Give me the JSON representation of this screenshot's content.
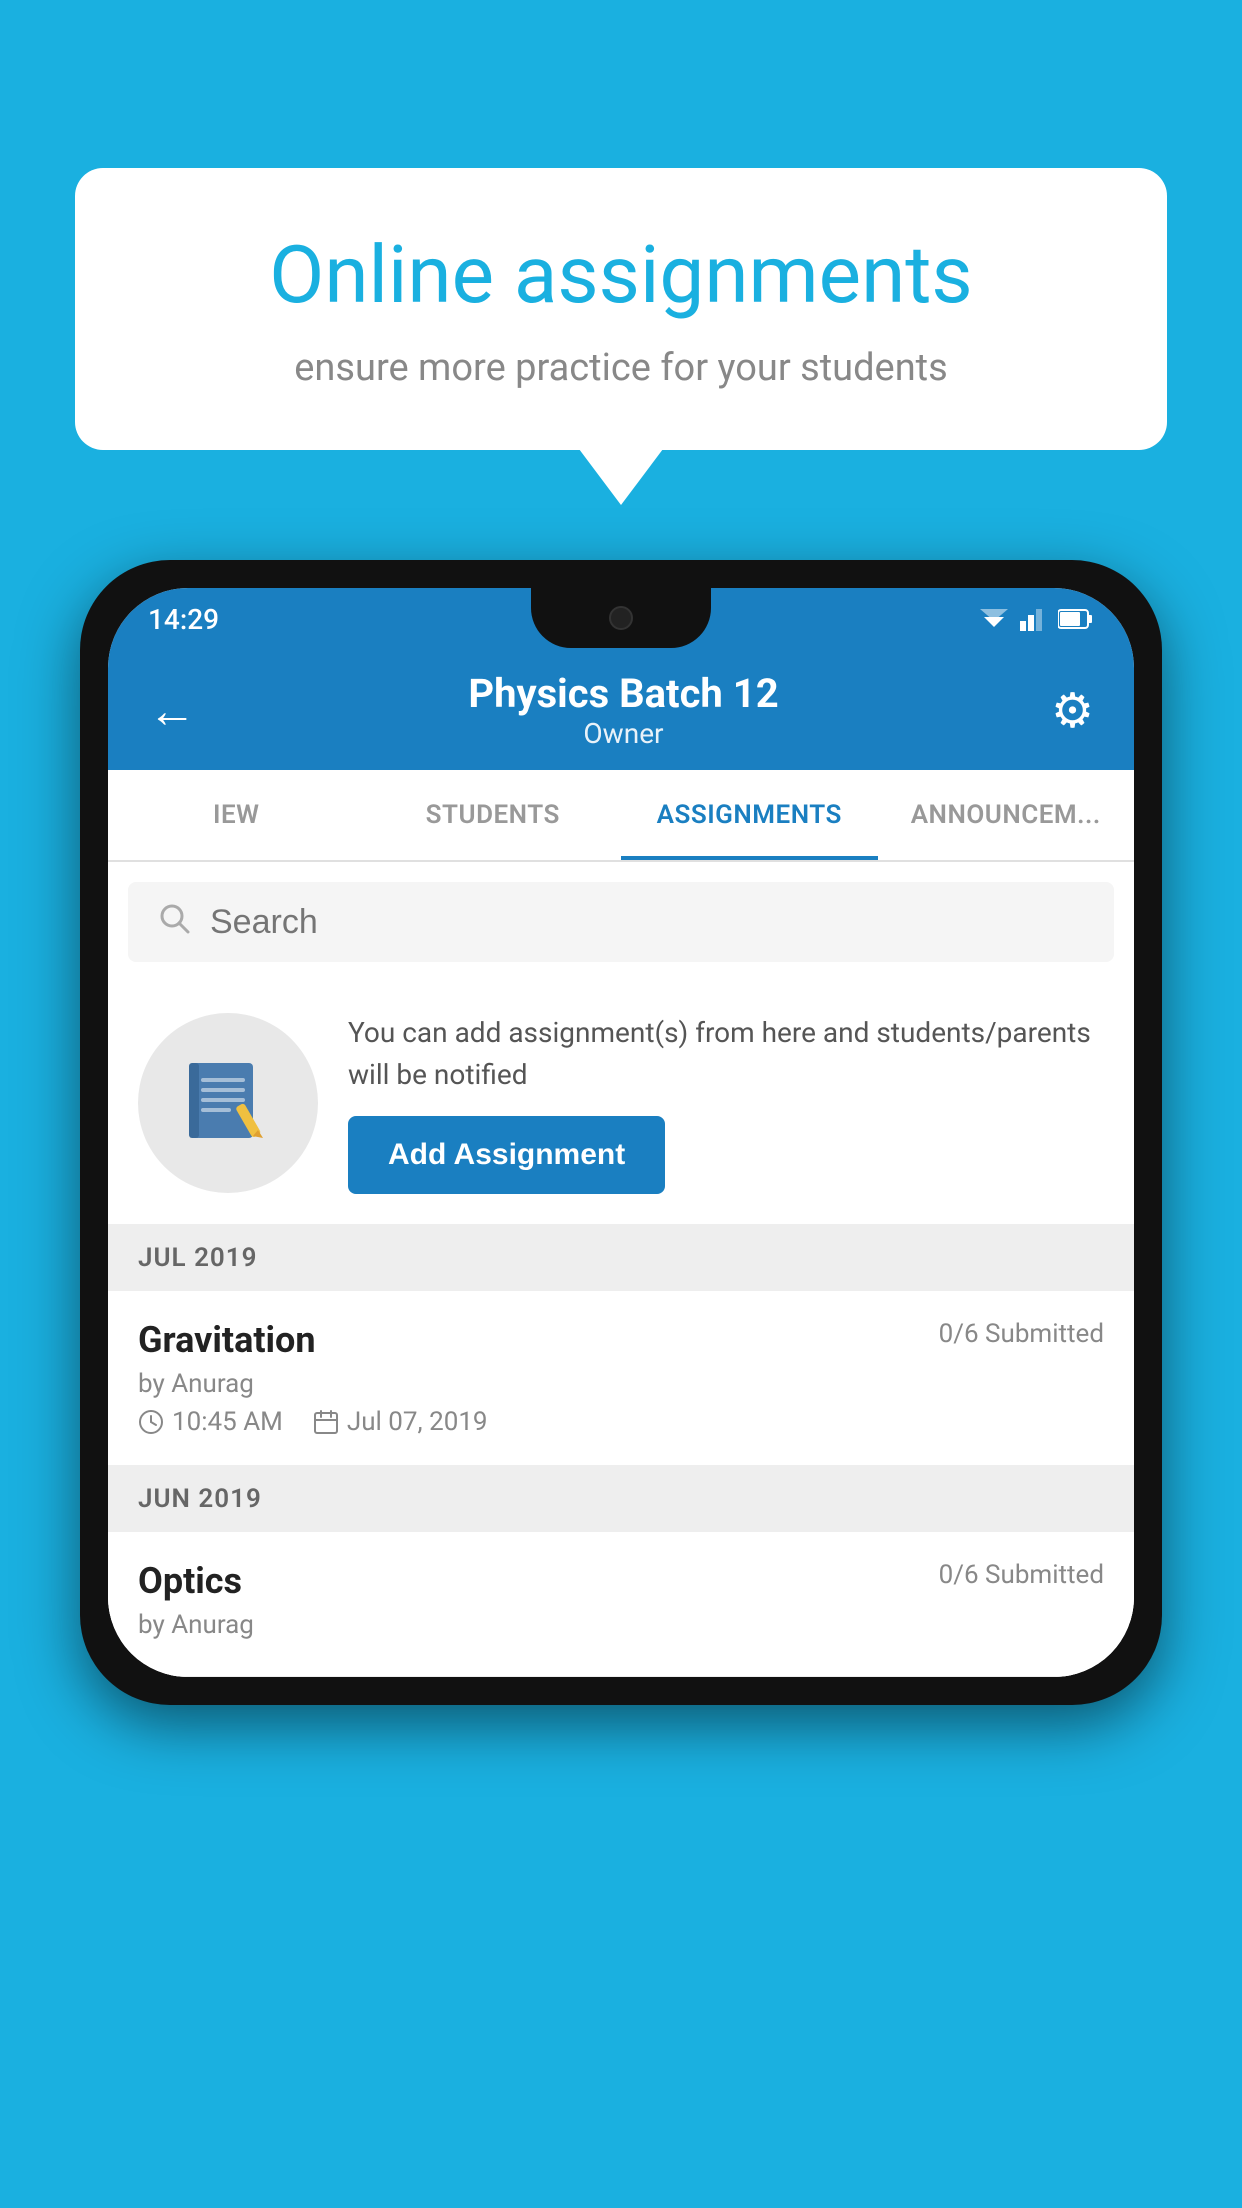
{
  "background_color": "#1ab0e0",
  "speech_bubble": {
    "title": "Online assignments",
    "subtitle": "ensure more practice for your students"
  },
  "status_bar": {
    "time": "14:29"
  },
  "app_bar": {
    "batch_title": "Physics Batch 12",
    "owner_label": "Owner"
  },
  "tabs": [
    {
      "label": "IEW",
      "active": false
    },
    {
      "label": "STUDENTS",
      "active": false
    },
    {
      "label": "ASSIGNMENTS",
      "active": true
    },
    {
      "label": "ANNOUNCEM...",
      "active": false
    }
  ],
  "search": {
    "placeholder": "Search"
  },
  "add_assignment": {
    "description": "You can add assignment(s) from here and students/parents will be notified",
    "button_label": "Add Assignment"
  },
  "months": [
    {
      "label": "JUL 2019",
      "assignments": [
        {
          "name": "Gravitation",
          "submitted": "0/6 Submitted",
          "author": "by Anurag",
          "time": "10:45 AM",
          "date": "Jul 07, 2019"
        }
      ]
    },
    {
      "label": "JUN 2019",
      "assignments": [
        {
          "name": "Optics",
          "submitted": "0/6 Submitted",
          "author": "by Anurag",
          "time": "",
          "date": ""
        }
      ]
    }
  ],
  "icons": {
    "back_arrow": "←",
    "settings": "⚙",
    "search": "🔍",
    "clock": "🕐",
    "calendar": "📅"
  }
}
